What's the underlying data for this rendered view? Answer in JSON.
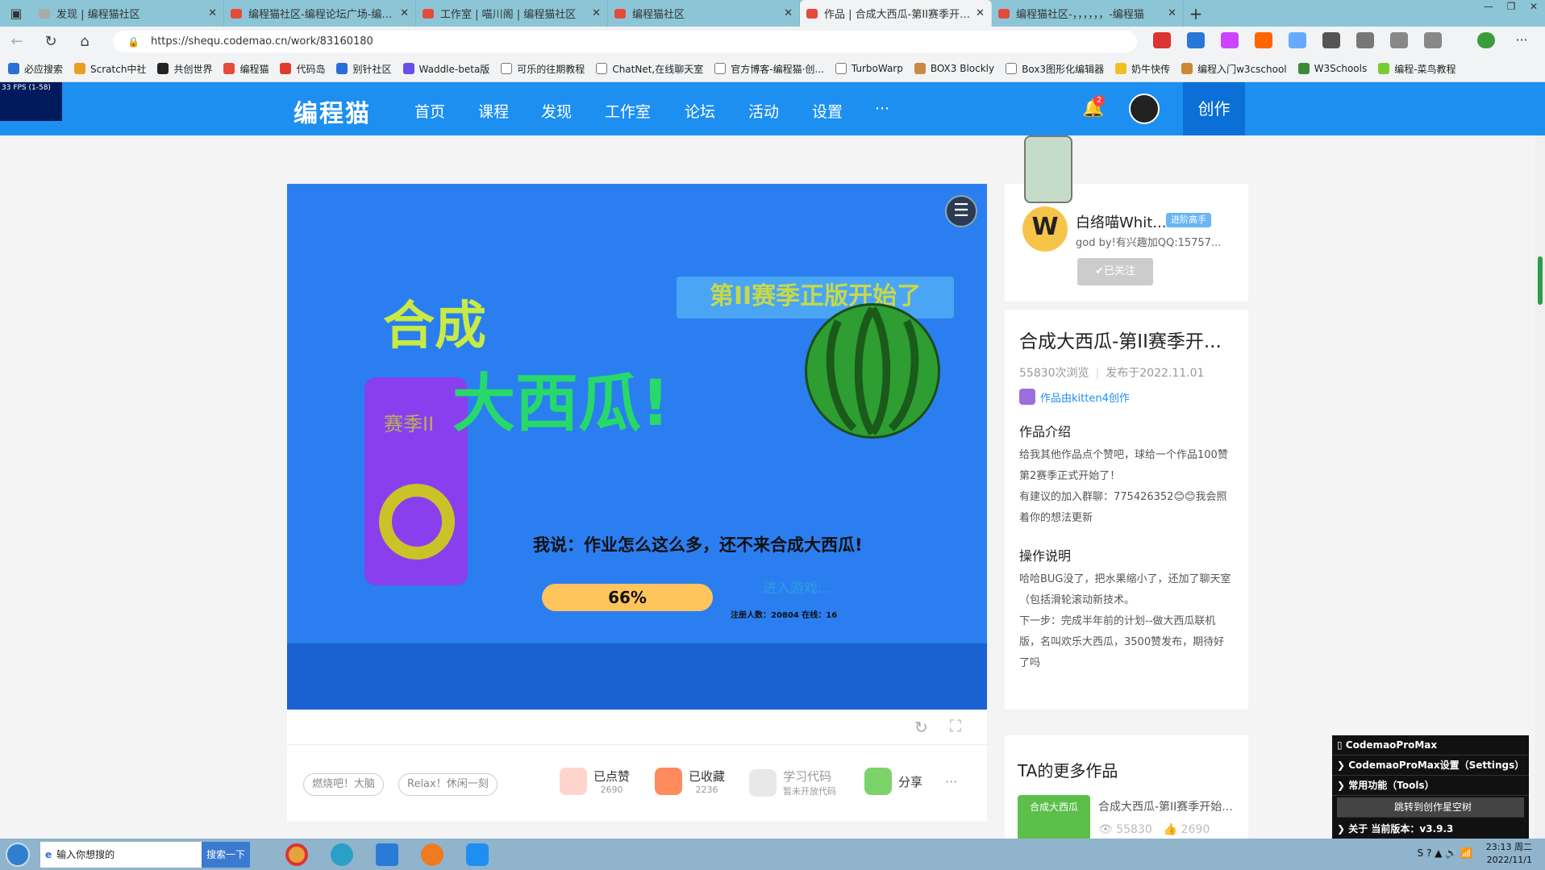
{
  "browser": {
    "tabs": [
      {
        "title": "发现 | 编程猫社区",
        "active": false
      },
      {
        "title": "编程猫社区-编程论坛广场-编程社",
        "active": false
      },
      {
        "title": "工作室 | 喵川阁 | 编程猫社区",
        "active": false
      },
      {
        "title": "编程猫社区",
        "active": false
      },
      {
        "title": "作品 | 合成大西瓜-第II赛季开始了",
        "active": true
      },
      {
        "title": "编程猫社区-，，，，，，-编程猫",
        "active": false
      }
    ],
    "url": "https://shequ.codemao.cn/work/83160180",
    "bookmarks": [
      "必应搜索",
      "Scratch中社",
      "共创世界",
      "编程猫",
      "代码岛",
      "别针社区",
      "Waddle-beta版",
      "可乐的往期教程",
      "ChatNet,在线聊天室",
      "官方博客-编程猫·创...",
      "TurboWarp",
      "BOX3 Blockly",
      "Box3图形化编辑器",
      "奶牛快传",
      "编程入门w3cschool",
      "W3Schools",
      "编程-菜鸟教程"
    ]
  },
  "fps": "33 FPS (1-58)",
  "site": {
    "logo": "编程猫",
    "nav": [
      "首页",
      "课程",
      "发现",
      "工作室",
      "论坛",
      "活动",
      "设置"
    ],
    "nav_more": "···",
    "notification_count": "2",
    "create_label": "创作"
  },
  "game": {
    "banner": "第II赛季正版开始了",
    "title_a": "合成",
    "title_b": "大西瓜!",
    "season": "赛季II",
    "slogan": "我说：作业怎么这么多，还不来合成大西瓜!",
    "progress": "66%",
    "progress_value": 0.66,
    "enter": "进入游戏...",
    "stats": "注册人数：20804 在线：16"
  },
  "actions": {
    "tags": [
      "燃烧吧！大脑",
      "Relax！休闲一刻"
    ],
    "like": {
      "label": "已点赞",
      "count": "2690"
    },
    "collect": {
      "label": "已收藏",
      "count": "2236"
    },
    "learn": {
      "label": "学习代码",
      "sub": "暂未开放代码"
    },
    "share": {
      "label": "分享"
    },
    "more": "···"
  },
  "author": {
    "avatar_letter": "W",
    "name": "白络喵Whit...",
    "badge": "进阶高手",
    "signature": "god by!有兴趣加QQ:15757...",
    "follow": "✔已关注"
  },
  "work": {
    "title": "合成大西瓜-第II赛季开...",
    "views": "55830次浏览",
    "published": "发布于2022.11.01",
    "created_with": "作品由kitten4创作",
    "intro_heading": "作品介绍",
    "intro": [
      "给我其他作品点个赞吧，球给一个作品100赞",
      "第2赛季正式开始了！",
      "有建议的加入群聊：775426352😊😊我会照着你的想法更新"
    ],
    "ops_heading": "操作说明",
    "ops": [
      "哈哈BUG没了，把水果缩小了，还加了聊天室（包括滑轮滚动新技术。",
      "下一步：完成半年前的计划--做大西瓜联机版，名叫欢乐大西瓜，3500赞发布，期待好了吗"
    ]
  },
  "more_works": {
    "heading": "TA的更多作品",
    "thumb_label": "合成大西瓜",
    "item": "合成大西瓜-第II赛季开始...",
    "views": "55830",
    "likes": "2690"
  },
  "cpm": {
    "title": "▯ CodemaoProMax",
    "settings": "CodemaoProMax设置（Settings）",
    "tools": "常用功能（Tools）",
    "jump": "跳转到创作星空树",
    "version": "关于 当前版本：v3.9.3"
  },
  "taskbar": {
    "search_placeholder": "输入你想搜的",
    "search_button": "搜索一下",
    "time": "23:13 周二",
    "date": "2022/11/1"
  }
}
